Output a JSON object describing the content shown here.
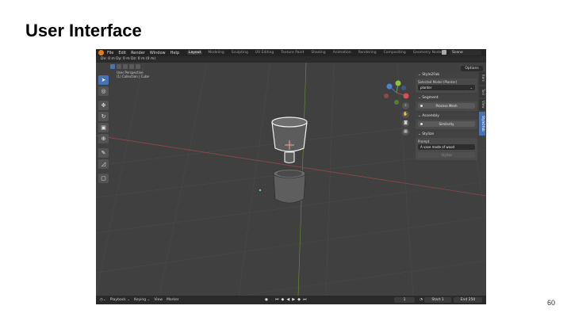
{
  "slide": {
    "title": "User Interface",
    "page_number": "60"
  },
  "app": {
    "menus": [
      "File",
      "Edit",
      "Render",
      "Window",
      "Help"
    ],
    "workspaces": [
      "Layout",
      "Modeling",
      "Sculpting",
      "UV Editing",
      "Texture Paint",
      "Shading",
      "Animation",
      "Rendering",
      "Compositing",
      "Geometry Nodes"
    ],
    "active_workspace": "Layout",
    "scene": "Scene",
    "status_line": "Dx: 0 m   Dy: 0 m   Dz: 0 m (0 m)",
    "options_label": "Options",
    "viewport_info": [
      "User Perspective",
      "(1) Collection | Cube"
    ]
  },
  "npanel": {
    "style2fab": {
      "header": "Style2Fab",
      "selected_model_label": "Selected Model (Planter)",
      "selected_model_value": "planter"
    },
    "segment": {
      "header": "Segment",
      "process_button": "Process Mesh"
    },
    "assembly": {
      "header": "Assembly",
      "similarity_button": "Similarity"
    },
    "stylize": {
      "header": "Stylize",
      "prompt_label": "Prompt",
      "prompt_value": "A vase made of wood",
      "stylize_button": "Stylize"
    },
    "side_tabs": [
      "Item",
      "Tool",
      "View",
      "Style2Fab"
    ],
    "active_tab": "Style2Fab"
  },
  "timeline": {
    "items": [
      "Playback",
      "Keying",
      "View",
      "Marker"
    ],
    "current_frame": "1",
    "start_label": "Start",
    "start_value": "1",
    "end_label": "End",
    "end_value": "250"
  },
  "colors": {
    "accent": "#4772b3",
    "x_axis": "#b04a4a",
    "y_axis": "#7aa33a",
    "z_axis": "#3f74c9"
  }
}
